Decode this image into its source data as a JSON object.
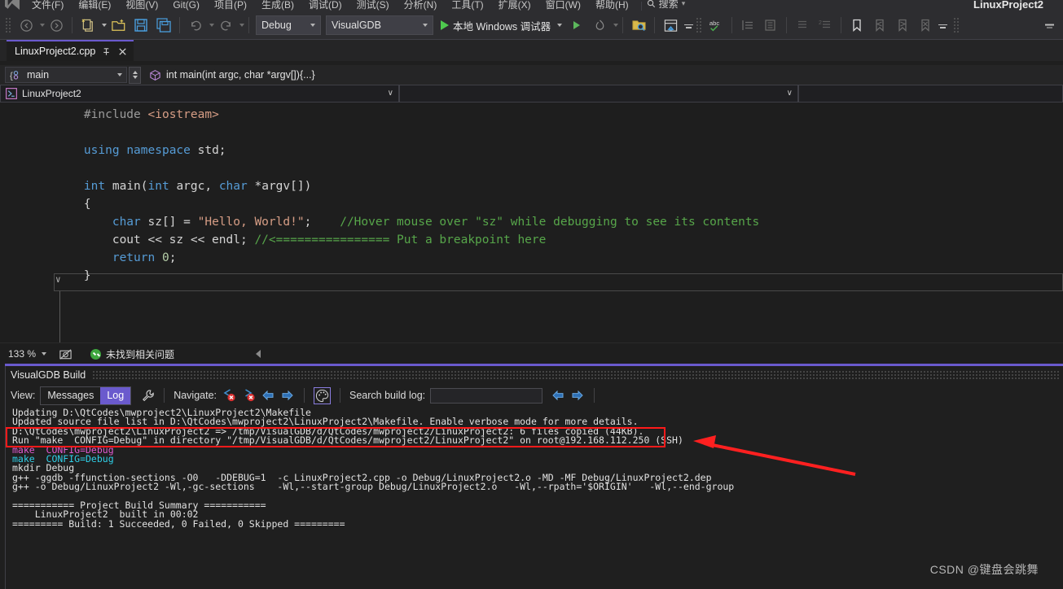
{
  "menu": {
    "logo_icon": "visual-studio-logo-icon",
    "items": [
      "文件(F)",
      "编辑(E)",
      "视图(V)",
      "Git(G)",
      "项目(P)",
      "生成(B)",
      "调试(D)",
      "测试(S)",
      "分析(N)",
      "工具(T)",
      "扩展(X)",
      "窗口(W)",
      "帮助(H)"
    ],
    "search_label": "搜索",
    "search_icon": "search-icon",
    "title": "LinuxProject2"
  },
  "toolbar": {
    "back_icon": "navigate-back-icon",
    "forward_icon": "navigate-forward-icon",
    "new_item_icon": "new-item-icon",
    "open_icon": "open-folder-icon",
    "save_icon": "save-icon",
    "save_all_icon": "save-all-icon",
    "undo_icon": "undo-icon",
    "redo_icon": "redo-icon",
    "config_value": "Debug",
    "platform_value": "VisualGDB",
    "run_label": "本地 Windows 调试器",
    "run_icon": "start-debug-icon",
    "attach_icon": "start-without-debugging-icon",
    "hot_reload_icon": "hot-reload-icon",
    "find_in_folder_icon": "folder-search-icon",
    "solution_explorer_icon": "solution-explorer-icon",
    "spell_check_icon": "spell-check-abc-icon",
    "outdent_icon": "outdent-icon",
    "indent_icon": "indent-icon",
    "comment_icon": "comment-lines-icon",
    "uncomment_icon": "uncomment-lines-icon",
    "bookmark_icon": "bookmark-icon",
    "prev_bookmark_icon": "previous-bookmark-icon",
    "next_bookmark_icon": "next-bookmark-icon",
    "clear_bookmarks_icon": "clear-bookmarks-icon",
    "overflow_icon": "toolbar-overflow-icon"
  },
  "tab": {
    "name": "LinuxProject2.cpp",
    "pin_icon": "pin-icon",
    "close_icon": "close-icon"
  },
  "navbar": {
    "member_icon": "member-scope-icon",
    "member_value": "main",
    "signature_icon": "method-cube-icon",
    "signature": "int main(int argc, char *argv[]){...}"
  },
  "projectrow": {
    "project_icon": "cpp-project-icon",
    "project_value": "LinuxProject2",
    "file_value": "",
    "member_value": ""
  },
  "code": {
    "lines": [
      [
        {
          "t": "    ",
          "c": "pl"
        },
        {
          "t": "#include ",
          "c": "pp"
        },
        {
          "t": "<iostream>",
          "c": "inc"
        }
      ],
      [],
      [
        {
          "t": "    ",
          "c": "pl"
        },
        {
          "t": "using",
          "c": "k"
        },
        {
          "t": " ",
          "c": "pl"
        },
        {
          "t": "namespace",
          "c": "k"
        },
        {
          "t": " std;",
          "c": "pl"
        }
      ],
      [],
      [
        {
          "t": "    ",
          "c": "pl"
        },
        {
          "t": "int",
          "c": "k"
        },
        {
          "t": " main(",
          "c": "pl"
        },
        {
          "t": "int",
          "c": "k"
        },
        {
          "t": " argc, ",
          "c": "pl"
        },
        {
          "t": "char",
          "c": "k"
        },
        {
          "t": " *argv[])",
          "c": "pl"
        }
      ],
      [
        {
          "t": "    {",
          "c": "pl"
        }
      ],
      [
        {
          "t": "        ",
          "c": "pl"
        },
        {
          "t": "char",
          "c": "k"
        },
        {
          "t": " sz[] = ",
          "c": "pl"
        },
        {
          "t": "\"Hello, World!\"",
          "c": "str"
        },
        {
          "t": ";    ",
          "c": "pl"
        },
        {
          "t": "//Hover mouse over \"sz\" while debugging to see its contents",
          "c": "cm"
        }
      ],
      [
        {
          "t": "        cout << sz << endl; ",
          "c": "pl"
        },
        {
          "t": "//<================ Put a breakpoint here",
          "c": "cm"
        }
      ],
      [
        {
          "t": "        ",
          "c": "pl"
        },
        {
          "t": "return",
          "c": "k"
        },
        {
          "t": " ",
          "c": "pl"
        },
        {
          "t": "0",
          "c": "num"
        },
        {
          "t": ";",
          "c": "pl"
        }
      ],
      [
        {
          "t": "    }",
          "c": "pl"
        }
      ]
    ]
  },
  "editor_status": {
    "zoom": "133 %",
    "zoom_caret_icon": "chevron-down-icon",
    "screen_reader_icon": "no-screenshot-icon",
    "issue_icon": "check-ok-icon",
    "issue_text": "未找到相关问题",
    "collapse_icon": "collapse-left-icon"
  },
  "build_panel": {
    "title": "VisualGDB Build",
    "view_label": "View:",
    "view_messages": "Messages",
    "view_log": "Log",
    "wrench_icon": "wrench-icon",
    "navigate_label": "Navigate:",
    "prev_error_icon": "previous-error-icon",
    "next_error_icon": "next-error-icon",
    "nav_back_icon": "navigate-back-arrow-icon",
    "nav_forward_icon": "navigate-forward-arrow-icon",
    "palette_icon": "color-palette-icon",
    "search_label": "Search build log:",
    "search_value": "",
    "search_placeholder": "",
    "search_prev_icon": "find-previous-icon",
    "search_next_icon": "find-next-icon",
    "log_lines": [
      {
        "text": "Updating D:\\QtCodes\\mwproject2\\LinuxProject2\\Makefile",
        "color": "default"
      },
      {
        "text": "Updated source file list in D:\\QtCodes\\mwproject2\\LinuxProject2\\Makefile. Enable verbose mode for more details.",
        "color": "default"
      },
      {
        "text": "D:\\QtCodes\\mwproject2\\LinuxProject2 => /tmp/VisualGDB/d/QtCodes/mwproject2/LinuxProject2: 6 files copied (44KB).",
        "color": "default"
      },
      {
        "text": "Run \"make  CONFIG=Debug\" in directory \"/tmp/VisualGDB/d/QtCodes/mwproject2/LinuxProject2\" on root@192.168.112.250 (SSH)",
        "color": "default"
      },
      {
        "text": "make  CONFIG=Debug",
        "color": "magenta"
      },
      {
        "text": "make  CONFIG=Debug",
        "color": "cyan"
      },
      {
        "text": "mkdir Debug",
        "color": "default"
      },
      {
        "text": "g++ -ggdb -ffunction-sections -O0   -DDEBUG=1  -c LinuxProject2.cpp -o Debug/LinuxProject2.o -MD -MF Debug/LinuxProject2.dep",
        "color": "default"
      },
      {
        "text": "g++ -o Debug/LinuxProject2 -Wl,-gc-sections    -Wl,--start-group Debug/LinuxProject2.o   -Wl,--rpath='$ORIGIN'   -Wl,--end-group",
        "color": "default"
      },
      {
        "text": "",
        "color": "default"
      },
      {
        "text": "=========== Project Build Summary ===========",
        "color": "default"
      },
      {
        "text": "    LinuxProject2  built in 00:02",
        "color": "default"
      },
      {
        "text": "========= Build: 1 Succeeded, 0 Failed, 0 Skipped =========",
        "color": "default"
      }
    ],
    "highlight_color": "#ff1a1a",
    "arrow_color": "#ff2020"
  },
  "watermark": "CSDN @键盘会跳舞"
}
